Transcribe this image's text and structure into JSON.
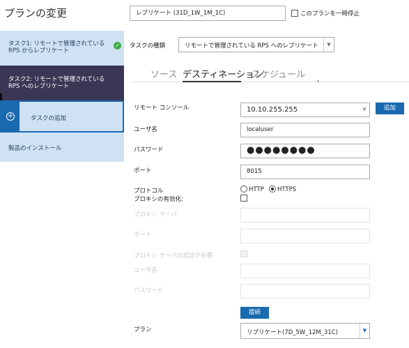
{
  "header": {
    "title": "プランの変更",
    "plan_name": "レプリケート (31D_1W_1M_1C)",
    "pause_label": "このプランを一時停止"
  },
  "sidebar": {
    "items": [
      {
        "label": "タスク1: リモートで管理されている RPS からレプリケート"
      },
      {
        "label": "タスク2: リモートで管理されている RPS へのレプリケート"
      },
      {
        "label": "タスクの追加"
      },
      {
        "label": "製品のインストール"
      }
    ]
  },
  "task_type": {
    "label": "タスクの種類",
    "value": "リモートで管理されている RPS へのレプリケート"
  },
  "tabs": [
    "ソース",
    "デスティネーション",
    "スケジュール"
  ],
  "form": {
    "remote_console_label": "リモート コンソール",
    "remote_console_value": "10.10.255.255",
    "add_button": "追加",
    "username_label": "ユーザ名",
    "username_value": "localuser",
    "password_label": "パスワード",
    "password_value": "●●●●●●●●",
    "port_label": "ポート",
    "port_value": "8015",
    "protocol_label": "プロトコル",
    "protocol_http": "HTTP",
    "protocol_https": "HTTPS",
    "proxy_enable_label": "プロキシの有効化:",
    "proxy_server_label": "プロキシ サーバ",
    "proxy_port_label": "ポート",
    "proxy_auth_label": "プロキシ サーバの認証が必要",
    "proxy_username_label": "ユーザ名",
    "proxy_password_label": "パスワード",
    "connect_button": "接続",
    "plan_label": "プラン",
    "plan_value": "リプリケート(7D_5W_12M_31C)"
  }
}
